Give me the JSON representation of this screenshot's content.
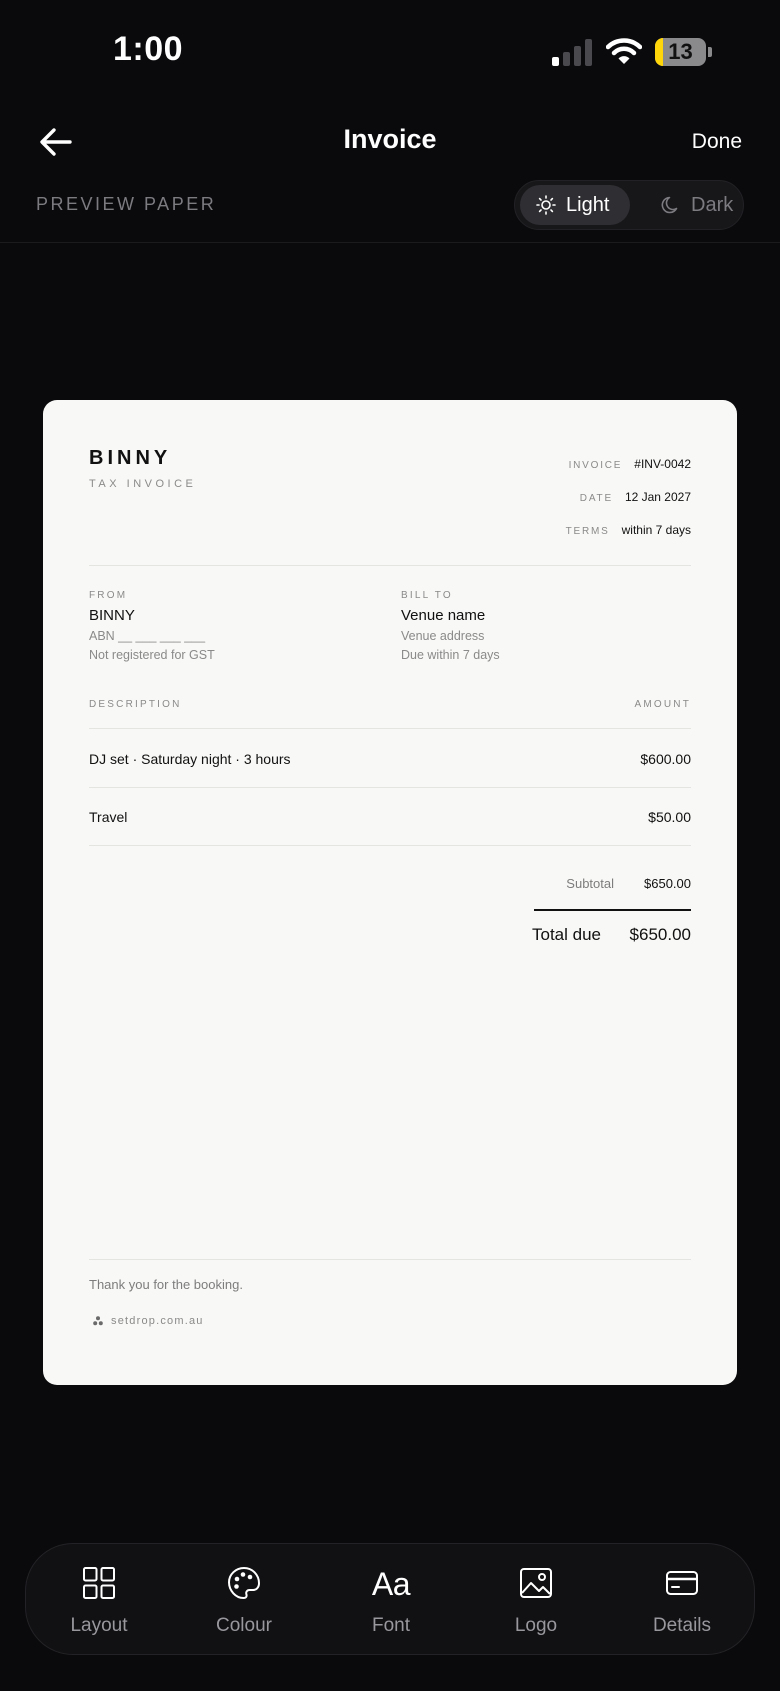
{
  "status_bar": {
    "time": "1:00",
    "battery": "13",
    "battery_level": 0.13
  },
  "nav": {
    "title": "Invoice",
    "done_label": "Done"
  },
  "preview": {
    "label": "PREVIEW PAPER",
    "light_label": "Light",
    "dark_label": "Dark",
    "selected": "Light"
  },
  "invoice": {
    "brand": "BINNY",
    "subtitle": "TAX INVOICE",
    "meta": [
      {
        "key": "INVOICE",
        "value": "#INV-0042"
      },
      {
        "key": "DATE",
        "value": "12 Jan 2027"
      },
      {
        "key": "TERMS",
        "value": "within 7 days"
      }
    ],
    "from": {
      "label": "FROM",
      "name": "BINNY",
      "abn": "ABN __ ___ ___ ___",
      "gst": "Not registered for GST"
    },
    "bill_to": {
      "label": "BILL TO",
      "name": "Venue name",
      "address": "Venue address",
      "due": "Due within 7 days"
    },
    "table_headers": {
      "description": "DESCRIPTION",
      "amount": "AMOUNT"
    },
    "items": [
      {
        "description": "DJ set · Saturday night · 3 hours",
        "amount": "$600.00"
      },
      {
        "description": "Travel",
        "amount": "$50.00"
      }
    ],
    "subtotal_label": "Subtotal",
    "subtotal": "$650.00",
    "total_label": "Total due",
    "total": "$650.00",
    "thanks": "Thank you for the booking.",
    "footer": "setdrop.com.au"
  },
  "toolbar": [
    {
      "label": "Layout",
      "icon": "layout-grid-icon"
    },
    {
      "label": "Colour",
      "icon": "palette-icon"
    },
    {
      "label": "Font",
      "icon": "font-icon"
    },
    {
      "label": "Logo",
      "icon": "image-icon"
    },
    {
      "label": "Details",
      "icon": "card-icon"
    }
  ],
  "colors": {
    "background": "#0a0a0c",
    "paper": "#f8f8f6",
    "battery": "#ffd60a"
  }
}
